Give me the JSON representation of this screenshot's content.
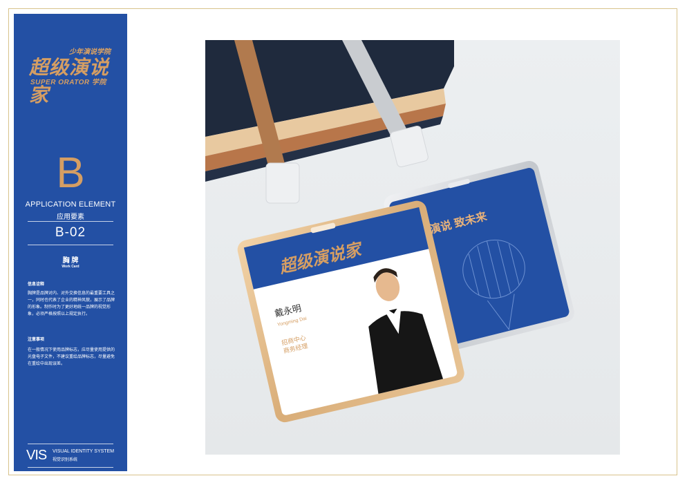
{
  "logo": {
    "cn_small": "少年演说学院",
    "cn_big": "超级演说家",
    "en": "SUPER ORATOR 学院"
  },
  "section": {
    "letter": "B",
    "title_en": "APPLICATION ELEMENT",
    "title_cn": "应用要素",
    "code": "B-02",
    "item_cn": "胸 牌",
    "item_en": "Work Card"
  },
  "info": {
    "title": "信息诠释",
    "body": "胸牌是品牌对内、对外交换信息的最重要工具之一，同时也代表了企业的精神风貌，展示了品牌的形象。制作时为了更好地统一品牌的视觉形象，必须严格按照以上规定执行。"
  },
  "notes": {
    "title": "注意事项",
    "body": "在一般情况下使用品牌标志，应尽量使用提供的光盘电子文件，不建议重绘品牌标志，尽量避免在重绘中出现误差。"
  },
  "footer": {
    "vis": "VIS",
    "en": "VISUAL IDENTITY SYSTEM",
    "cn": "视觉识别系统"
  },
  "card_front": {
    "name": "戴永明",
    "name_en": "Yongming Dai",
    "dept": "招商中心",
    "title": "商务经理"
  },
  "card_back": {
    "slogan": "用演说 致未来"
  },
  "colors": {
    "brand_blue": "#2350a4",
    "gold": "#d59e63",
    "frame": "#d8c28a"
  }
}
